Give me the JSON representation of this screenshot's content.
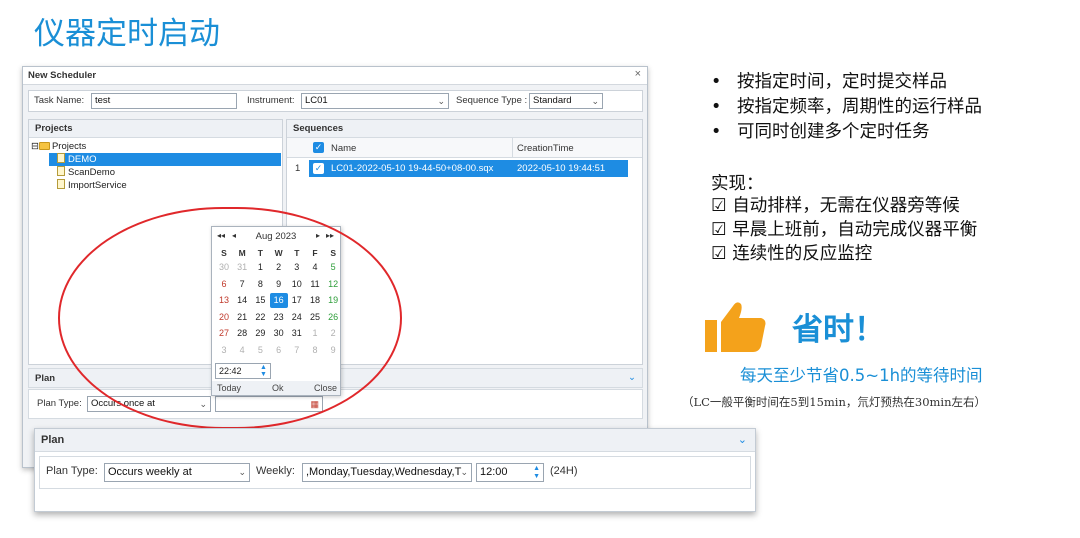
{
  "slide_title": "仪器定时启动",
  "scheduler": {
    "window_title": "New Scheduler",
    "close_glyph": "×",
    "task_name_label": "Task Name:",
    "task_name_value": "test",
    "instrument_label": "Instrument:",
    "instrument_value": "LC01",
    "sequence_type_label": "Sequence Type :",
    "sequence_type_value": "Standard",
    "projects_header": "Projects",
    "tree": {
      "root": "Projects",
      "items": [
        "DEMO",
        "ScanDemo",
        "ImportService"
      ],
      "selected": "DEMO"
    },
    "sequences_header": "Sequences",
    "columns": [
      "Name",
      "CreationTime"
    ],
    "rows": [
      {
        "index": "1",
        "name": "LC01-2022-05-10 19-44-50+08-00.sqx",
        "time": "2022-05-10 19:44:51"
      }
    ],
    "plan_header": "Plan",
    "plan_type_label": "Plan Type:",
    "plan_type_value": "Occurs once at"
  },
  "calendar": {
    "month_label": "Aug 2023",
    "nav_prev_year": "◂◂",
    "nav_prev": "◂",
    "nav_next": "▸",
    "nav_next_year": "▸▸",
    "weekdays": [
      "S",
      "M",
      "T",
      "W",
      "T",
      "F",
      "S"
    ],
    "weeks": [
      [
        "30",
        "31",
        "1",
        "2",
        "3",
        "4",
        "5"
      ],
      [
        "6",
        "7",
        "8",
        "9",
        "10",
        "11",
        "12"
      ],
      [
        "13",
        "14",
        "15",
        "16",
        "17",
        "18",
        "19"
      ],
      [
        "20",
        "21",
        "22",
        "23",
        "24",
        "25",
        "26"
      ],
      [
        "27",
        "28",
        "29",
        "30",
        "31",
        "1",
        "2"
      ],
      [
        "3",
        "4",
        "5",
        "6",
        "7",
        "8",
        "9"
      ]
    ],
    "selected_day": "16",
    "time": "22:42",
    "buttons": [
      "Today",
      "Ok",
      "Close"
    ]
  },
  "plan_overlay": {
    "header": "Plan",
    "plan_type_label": "Plan Type:",
    "plan_type_value": "Occurs weekly at",
    "weekly_label": "Weekly:",
    "weekly_value": ",Monday,Tuesday,Wednesday,T",
    "time_value": "12:00",
    "time_format": "(24H)"
  },
  "features": [
    "按指定时间，定时提交样品",
    "按指定频率，周期性的运行样品",
    "可同时创建多个定时任务"
  ],
  "implementation_title": "实现：",
  "implementation": [
    "☑ 自动排样，无需在仪器旁等候",
    "☑ 早晨上班前，自动完成仪器平衡",
    "☑ 连续性的反应监控"
  ],
  "save_time_heading": "省时！",
  "save_time_line": "每天至少节省0.5~1h的等待时间",
  "note": "（LC一般平衡时间在5到15min，氘灯预热在30min左右）",
  "colors": {
    "accent": "#1a8fd6",
    "selection": "#1e8ce3",
    "highlight_ellipse": "#e0282b",
    "thumb": "#f4a21b"
  }
}
